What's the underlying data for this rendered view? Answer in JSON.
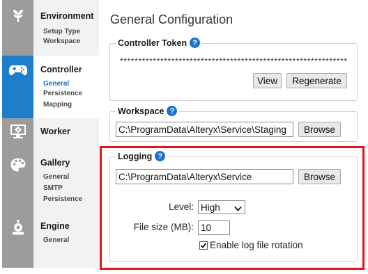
{
  "sidebar": {
    "sections": [
      {
        "title": "Environment",
        "icon": "leaf-icon",
        "items": [
          "Setup Type",
          "Workspace"
        ]
      },
      {
        "title": "Controller",
        "icon": "gamepad-icon",
        "items": [
          "General",
          "Persistence",
          "Mapping"
        ],
        "active_item": "General"
      },
      {
        "title": "Worker",
        "icon": "computer-gear-icon",
        "items": []
      },
      {
        "title": "Gallery",
        "icon": "palette-icon",
        "items": [
          "General",
          "SMTP",
          "Persistence"
        ]
      },
      {
        "title": "Engine",
        "icon": "engine-icon",
        "items": [
          "General"
        ]
      }
    ]
  },
  "page": {
    "title": "General Configuration"
  },
  "controller_token": {
    "legend": "Controller Token",
    "help": "?",
    "token": "**************************************************************",
    "view_label": "View",
    "regenerate_label": "Regenerate"
  },
  "workspace": {
    "legend": "Workspace",
    "help": "?",
    "path": "C:\\ProgramData\\Alteryx\\Service\\Staging",
    "browse_label": "Browse"
  },
  "logging": {
    "legend": "Logging",
    "help": "?",
    "path": "C:\\ProgramData\\Alteryx\\Service",
    "browse_label": "Browse",
    "level_label": "Level:",
    "level_value": "High",
    "file_size_label": "File size (MB):",
    "file_size_value": "10",
    "rotation_label": "Enable log file rotation",
    "rotation_checked": true
  },
  "colors": {
    "accent": "#1d7fcb",
    "highlight": "#e4121b",
    "sidebar_icons": "#9c9c9c"
  }
}
